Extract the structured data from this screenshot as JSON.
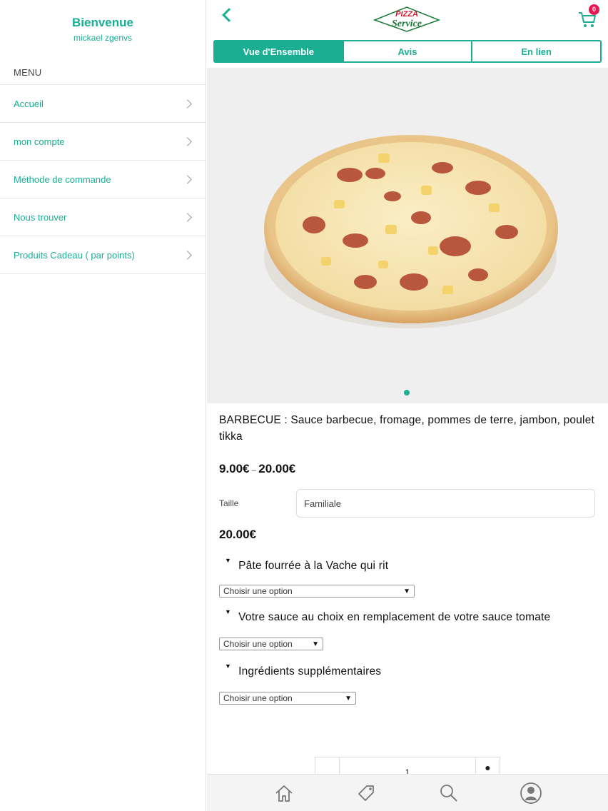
{
  "sidebar": {
    "welcome": "Bienvenue",
    "user": "mickael zgenvs",
    "menu_label": "MENU",
    "items": [
      {
        "label": "Accueil"
      },
      {
        "label": "mon compte"
      },
      {
        "label": "Méthode de commande"
      },
      {
        "label": "Nous trouver"
      },
      {
        "label": "Produits Cadeau ( par points)"
      }
    ]
  },
  "header": {
    "logo_top": "PIZZA",
    "logo_bottom": "Service",
    "cart_count": "0"
  },
  "tabs": [
    {
      "label": "Vue d'Ensemble",
      "active": true
    },
    {
      "label": "Avis",
      "active": false
    },
    {
      "label": "En lien",
      "active": false
    }
  ],
  "product": {
    "description": "BARBECUE : Sauce barbecue, fromage, pommes de terre, jambon, poulet tikka",
    "price_min": "9.00€",
    "price_sep": "–",
    "price_max": "20.00€",
    "size_label": "Taille",
    "size_value": "Familiale",
    "price": "20.00€",
    "options": [
      {
        "title": "Pâte fourrée à la Vache qui rit",
        "selected": "Choisir une option"
      },
      {
        "title": "Votre sauce au choix en remplacement de votre sauce tomate",
        "selected": "Choisir une option"
      },
      {
        "title": "Ingrédients supplémentaires",
        "selected": "Choisir une option"
      }
    ],
    "quantity": "1"
  },
  "colors": {
    "accent": "#1aae93",
    "badge": "#e8174f",
    "logo_red": "#d7192f",
    "logo_green": "#1c7a3a"
  },
  "icons": {
    "back": "chevron-left-icon",
    "cart": "cart-icon",
    "home": "home-icon",
    "tag": "tag-icon",
    "search": "search-icon",
    "profile": "profile-icon"
  }
}
